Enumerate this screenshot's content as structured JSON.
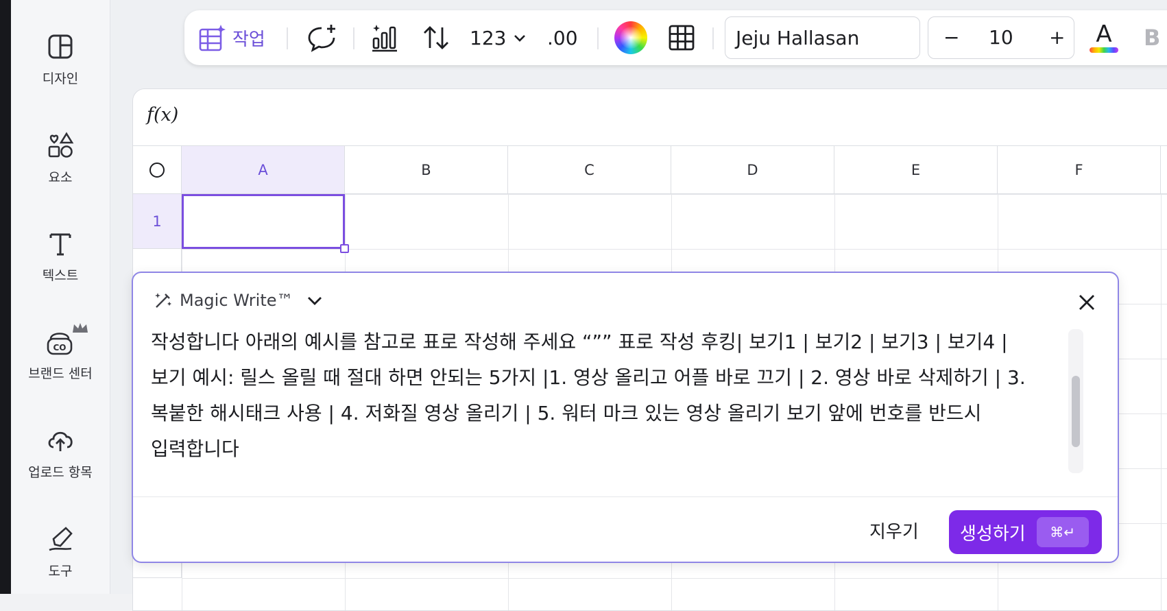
{
  "sidebar": {
    "items": [
      {
        "label": "디자인",
        "icon": "layout-icon"
      },
      {
        "label": "요소",
        "icon": "shapes-icon"
      },
      {
        "label": "텍스트",
        "icon": "text-icon"
      },
      {
        "label": "브랜드 센터",
        "icon": "brand-kit-icon"
      },
      {
        "label": "업로드 항목",
        "icon": "cloud-upload-icon"
      },
      {
        "label": "도구",
        "icon": "pen-tool-icon"
      }
    ]
  },
  "toolbar": {
    "actions_label": "작업",
    "number_format_label": "123",
    "decimal_label": ".00",
    "font_family": "Jeju Hallasan",
    "font_size": "10",
    "minus": "−",
    "plus": "+",
    "bold": "B",
    "text_color": "A"
  },
  "sheet": {
    "formula_label": "f(x)",
    "columns": [
      "A",
      "B",
      "C",
      "D",
      "E",
      "F"
    ],
    "rows": [
      "1"
    ]
  },
  "magic_write": {
    "title": "Magic Write™",
    "prompt_lines": [
      "작성합니다 아래의 예시를 참고로 표로 작성해 주세요 “””  표로 작성 후킹| 보기1 | 보기2 | 보기3 | 보기4 |",
      "보기 예시: 릴스 올릴 때 절대 하면 안되는 5가지 |1. 영상 올리고 어플 바로 끄기 | 2. 영상 바로 삭제하기 | 3.",
      "복붙한 해시태크 사용 | 4. 저화질 영상 올리기 | 5. 워터 마크 있는 영상 올리기 보기 앞에 번호를 반드시",
      "입력합니다"
    ],
    "clear_label": "지우기",
    "generate_label": "생성하기",
    "shortcut": "⌘↵"
  },
  "colors": {
    "accent": "#7d2ae8",
    "selection": "#7b4ee0",
    "header_selected_bg": "#efebfb"
  }
}
